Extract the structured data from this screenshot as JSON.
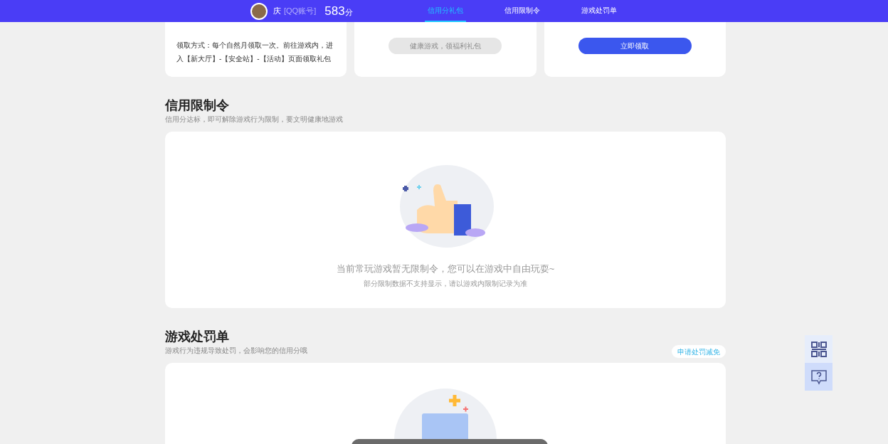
{
  "header": {
    "user_name": "庆",
    "account_type": "[QQ账号]",
    "score": "583",
    "score_unit": "分",
    "tabs": [
      {
        "label": "信用分礼包",
        "selected": true
      },
      {
        "label": "信用限制令",
        "selected": false
      },
      {
        "label": "游戏处罚单",
        "selected": false
      }
    ]
  },
  "gift_cards": [
    {
      "kind": "text",
      "text": "领取方式：每个自然月领取一次。前往游戏内，进入【新大厅】-【安全站】-【活动】页面领取礼包"
    },
    {
      "kind": "button",
      "label": "健康游戏，领福利礼包",
      "disabled": true
    },
    {
      "kind": "button",
      "label": "立即领取",
      "disabled": false
    }
  ],
  "restriction": {
    "title": "信用限制令",
    "subtitle": "信用分达标，即可解除游戏行为限制，要文明健康地游戏",
    "empty_message": "当前常玩游戏暂无限制令，您可以在游戏中自由玩耍~",
    "note": "部分限制数据不支持显示，请以游戏内限制记录为准"
  },
  "penalty": {
    "title": "游戏处罚单",
    "subtitle": "游戏行为违规导致处罚，会影响您的信用分哦",
    "action": "申请处罚减免"
  }
}
